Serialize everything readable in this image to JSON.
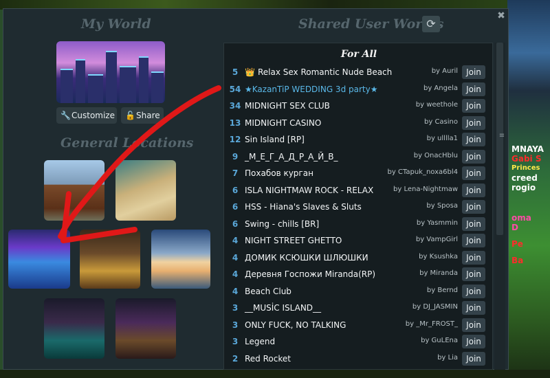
{
  "titles": {
    "my_world": "My World",
    "shared": "Shared User Worlds",
    "general": "General Locations"
  },
  "icons": {
    "refresh": "refresh-icon",
    "close": "close-icon",
    "customize": "wrench-icon",
    "share": "lock-icon",
    "crown": "crown-icon"
  },
  "buttons": {
    "customize": "Customize",
    "share": "Share",
    "close_glyph": "✖",
    "refresh_glyph": "⟳",
    "join": "Join"
  },
  "list": {
    "header": "For All",
    "rows": [
      {
        "count": "5",
        "name": "Relax Sex Romantic Nude Beach",
        "by": "by  Auril",
        "crown": true
      },
      {
        "count": "54",
        "name": "★KazanTiP WEDDING 3d party★",
        "by": "by  Angela",
        "highlight": true
      },
      {
        "count": "34",
        "name": "MIDNIGHT SEX CLUB",
        "by": "by  weethole"
      },
      {
        "count": "13",
        "name": "MIDNIGHT CASINO",
        "by": "by  Casino"
      },
      {
        "count": "12",
        "name": "Sin Island [RP]",
        "by": "by  ulllla1"
      },
      {
        "count": "9",
        "name": "_М_Е_Г_А_Д_Р_А_Й_В_",
        "by": "by  OnacHblu"
      },
      {
        "count": "7",
        "name": "Похабов курган",
        "by": "by  CTapuk_noxa6bl4"
      },
      {
        "count": "6",
        "name": "ISLA NIGHTMAW ROCK - RELAX",
        "by": "by  Lena-Nightmaw"
      },
      {
        "count": "6",
        "name": "HSS - Hiana's Slaves & Sluts",
        "by": "by  Sposa"
      },
      {
        "count": "6",
        "name": "Swing - chills [BR]",
        "by": "by  Yasmmin"
      },
      {
        "count": "4",
        "name": "NIGHT STREET GHETTO",
        "by": "by  VampGirl"
      },
      {
        "count": "4",
        "name": "ДОМИК КСЮШКИ ШЛЮШКИ",
        "by": "by  Ksushka"
      },
      {
        "count": "4",
        "name": "Деревня Госпожи Miranda(RP)",
        "by": "by  Miranda"
      },
      {
        "count": "4",
        "name": "Beach Club",
        "by": "by  Bernd"
      },
      {
        "count": "3",
        "name": "__MUSİC ISLAND__",
        "by": "by  DJ_JASMIN"
      },
      {
        "count": "3",
        "name": "ONLY FUCK, NO TALKING",
        "by": "by  _Mr_FROST_"
      },
      {
        "count": "3",
        "name": "Legend",
        "by": "by  GuLEna"
      },
      {
        "count": "2",
        "name": "Red Rocket",
        "by": "by  Lia"
      }
    ]
  },
  "background_names": [
    "MNAYA",
    "Gabi S",
    "Princes",
    "creed",
    "rogio",
    "oma",
    "D",
    "Pe",
    "Ba"
  ],
  "colors": {
    "panel": "#1f2b30",
    "list_bg": "#151d20",
    "count": "#5aa7d8",
    "highlight": "#5ab8e8",
    "annotation_arrow": "#e01818"
  }
}
